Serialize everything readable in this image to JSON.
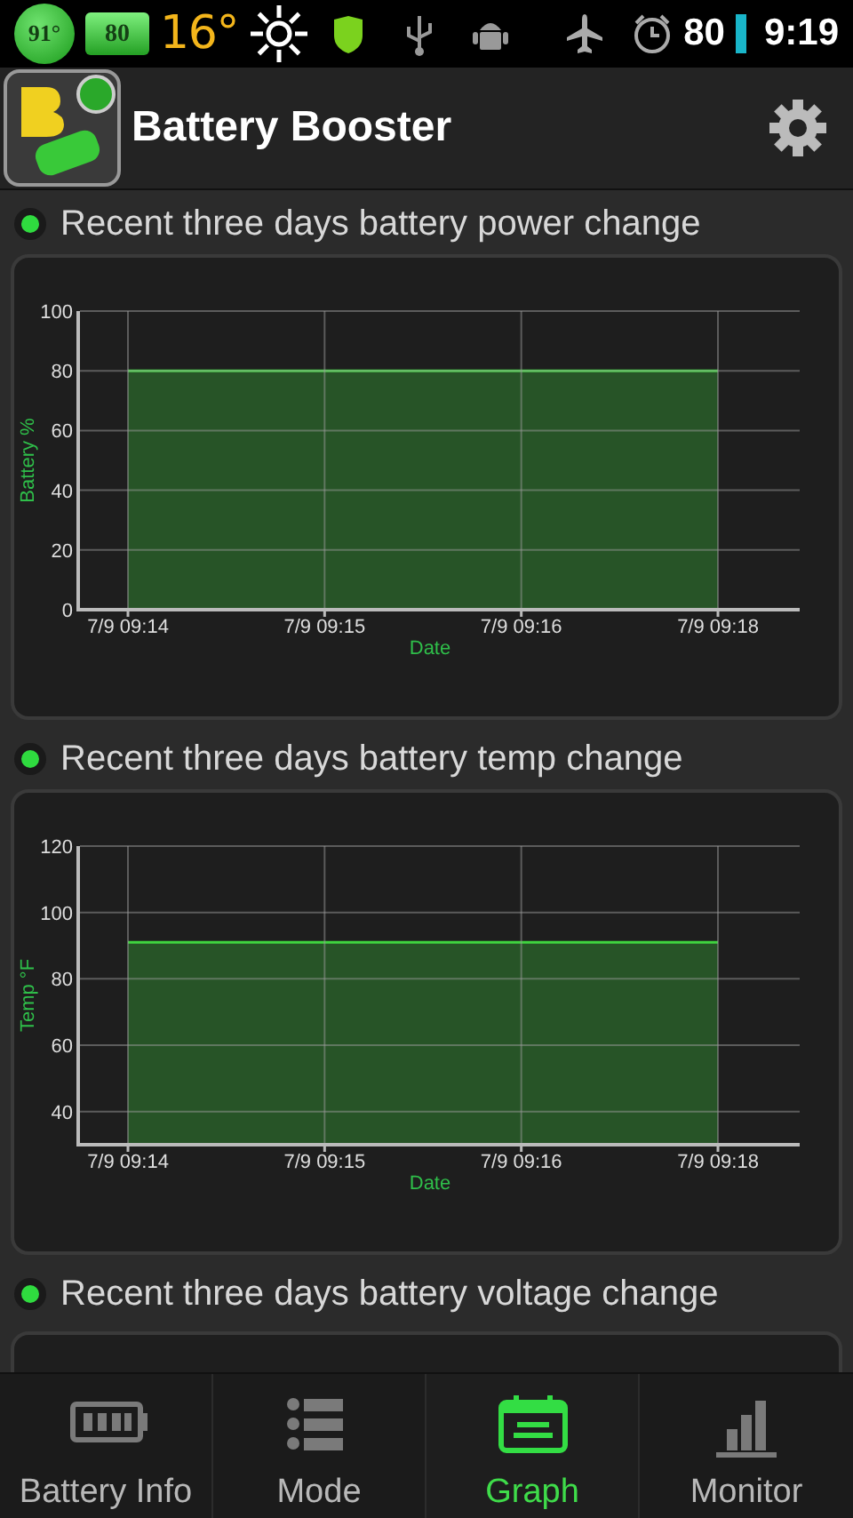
{
  "status_bar": {
    "battery_temp": "91°",
    "battery_level": "80",
    "weather_temp": "16°",
    "battery_percent": "80",
    "time": "9:19"
  },
  "app_bar": {
    "title": "Battery Booster"
  },
  "sections": [
    {
      "title": "Recent three days battery power change",
      "chart_data": {
        "type": "area",
        "xlabel": "Date",
        "ylabel": "Battery %",
        "categories": [
          "7/9 09:14",
          "7/9 09:15",
          "7/9 09:16",
          "7/9 09:18"
        ],
        "series": [
          {
            "color": "#3fd43f",
            "values": [
              80,
              80,
              80,
              80
            ]
          }
        ],
        "ylim": [
          0,
          100
        ],
        "yticks": [
          0,
          20,
          40,
          60,
          80,
          100
        ],
        "grid": true
      }
    },
    {
      "title": "Recent three days battery temp change",
      "chart_data": {
        "type": "area",
        "xlabel": "Date",
        "ylabel": "Temp °F",
        "categories": [
          "7/9 09:14",
          "7/9 09:15",
          "7/9 09:16",
          "7/9 09:18"
        ],
        "series": [
          {
            "color": "#3fd43f",
            "values": [
              91,
              91,
              91,
              91
            ]
          }
        ],
        "ylim": [
          30,
          120
        ],
        "yticks": [
          40,
          60,
          80,
          100,
          120
        ],
        "grid": true
      }
    },
    {
      "title": "Recent three days battery voltage change"
    }
  ],
  "tabs": [
    {
      "label": "Battery Info",
      "kind": "battery",
      "selected": false
    },
    {
      "label": "Mode",
      "kind": "list",
      "selected": false
    },
    {
      "label": "Graph",
      "kind": "calendar",
      "selected": true
    },
    {
      "label": "Monitor",
      "kind": "bars",
      "selected": false
    }
  ]
}
